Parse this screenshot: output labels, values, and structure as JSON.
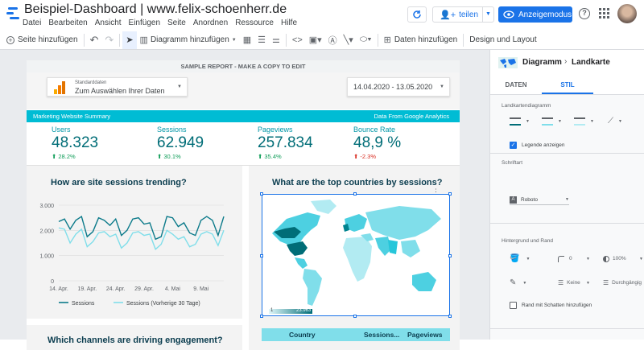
{
  "app": {
    "title": "Beispiel-Dashboard | www.felix-schoenherr.de"
  },
  "menu": [
    "Datei",
    "Bearbeiten",
    "Ansicht",
    "Einfügen",
    "Seite",
    "Anordnen",
    "Ressource",
    "Hilfe"
  ],
  "header_actions": {
    "share_label": "teilen",
    "view_mode_label": "Anzeigemodus"
  },
  "toolbar": {
    "add_page": "Seite hinzufügen",
    "add_chart": "Diagramm hinzufügen",
    "add_data": "Daten hinzufügen",
    "design_layout": "Design und Layout"
  },
  "report": {
    "title": "SAMPLE REPORT - MAKE A COPY TO EDIT",
    "datasource_label": "Standarddaten",
    "datasource_value": "Zum Auswählen Ihrer Daten",
    "date_range": "14.04.2020 - 13.05.2020",
    "banner_left": "Marketing Website Summary",
    "banner_right": "Data From Google Analytics",
    "kpis": [
      {
        "label": "Users",
        "value": "48.323",
        "delta": "28.2%",
        "dir": "up"
      },
      {
        "label": "Sessions",
        "value": "62.949",
        "delta": "30.1%",
        "dir": "up"
      },
      {
        "label": "Pageviews",
        "value": "257.834",
        "delta": "35.4%",
        "dir": "up"
      },
      {
        "label": "Bounce Rate",
        "value": "48,9 %",
        "delta": "-2.3%",
        "dir": "down"
      }
    ],
    "line_chart_title": "How are site sessions trending?",
    "map_title": "What are the top countries by sessions?",
    "bottom_title": "Which channels are driving engagement?",
    "map_scale_min": "1",
    "map_scale_max": "23.963",
    "map_table_headers": [
      "Country",
      "Sessions...",
      "Pageviews"
    ]
  },
  "chart_data": {
    "type": "line",
    "x": [
      "14. Apr.",
      "15. Apr.",
      "16. Apr.",
      "17. Apr.",
      "18. Apr.",
      "19. Apr.",
      "20. Apr.",
      "21. Apr.",
      "22. Apr.",
      "23. Apr.",
      "24. Apr.",
      "25. Apr.",
      "26. Apr.",
      "27. Apr.",
      "28. Apr.",
      "29. Apr.",
      "30. Apr.",
      "1. Mai",
      "2. Mai",
      "3. Mai",
      "4. Mai",
      "5. Mai",
      "6. Mai",
      "7. Mai",
      "8. Mai",
      "9. Mai",
      "10. Mai",
      "11. Mai",
      "12. Mai",
      "13. Mai"
    ],
    "xticks": [
      "14. Apr.",
      "19. Apr.",
      "24. Apr.",
      "29. Apr.",
      "4. Mai",
      "9. Mai"
    ],
    "yticks": [
      "3.000",
      "2.000",
      "1.000",
      "0"
    ],
    "ylim": [
      0,
      3000
    ],
    "series": [
      {
        "name": "Sessions",
        "color": "#0b7a8a",
        "values": [
          2350,
          2450,
          2050,
          2400,
          2550,
          1750,
          1950,
          2500,
          2400,
          2200,
          2450,
          1800,
          2000,
          2450,
          2500,
          2250,
          2300,
          1650,
          1750,
          2550,
          2500,
          2150,
          2300,
          1900,
          1800,
          2400,
          2550,
          2400,
          1800,
          2550
        ]
      },
      {
        "name": "Sessions (Vorherige 30 Tage)",
        "color": "#80deea",
        "values": [
          2100,
          2050,
          1500,
          1850,
          2050,
          1350,
          1550,
          1900,
          1950,
          1750,
          1850,
          1300,
          1500,
          1900,
          1950,
          1800,
          1850,
          1250,
          1450,
          2000,
          1850,
          1650,
          1750,
          1350,
          1450,
          1850,
          1950,
          1850,
          1400,
          2000
        ]
      }
    ]
  },
  "panel": {
    "breadcrumb_chart": "Diagramm",
    "breadcrumb_type": "Landkarte",
    "tab_data": "DATEN",
    "tab_style": "STIL",
    "map_chart_label": "Landkartendiagramm",
    "show_legend": "Legende anzeigen",
    "font_label": "Schriftart",
    "font_value": "Roboto",
    "bg_border_label": "Hintergrund und Rand",
    "border_radius": "0",
    "opacity": "100%",
    "border_weight": "Keine",
    "border_style": "Durchgängig",
    "shadow_label": "Rand mit Schatten hinzufügen"
  },
  "colors": {
    "accent": "#00bcd4",
    "primary_blue": "#1a73e8",
    "dark_teal": "#006d77"
  }
}
